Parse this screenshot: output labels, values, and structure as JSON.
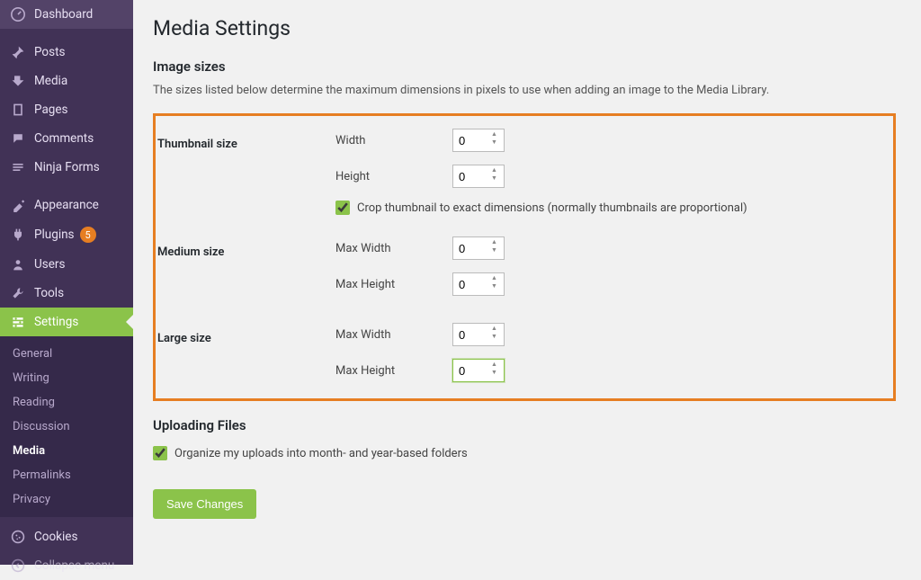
{
  "sidebar": {
    "items": [
      {
        "icon": "dashboard",
        "label": "Dashboard"
      },
      {
        "icon": "pin",
        "label": "Posts"
      },
      {
        "icon": "media",
        "label": "Media"
      },
      {
        "icon": "page",
        "label": "Pages"
      },
      {
        "icon": "comment",
        "label": "Comments"
      },
      {
        "icon": "form",
        "label": "Ninja Forms"
      },
      {
        "icon": "appearance",
        "label": "Appearance"
      },
      {
        "icon": "plugin",
        "label": "Plugins",
        "badge": "5"
      },
      {
        "icon": "user",
        "label": "Users"
      },
      {
        "icon": "tool",
        "label": "Tools"
      },
      {
        "icon": "settings",
        "label": "Settings"
      }
    ],
    "submenu": [
      {
        "label": "General"
      },
      {
        "label": "Writing"
      },
      {
        "label": "Reading"
      },
      {
        "label": "Discussion"
      },
      {
        "label": "Media",
        "current": true
      },
      {
        "label": "Permalinks"
      },
      {
        "label": "Privacy"
      }
    ],
    "footer": [
      {
        "icon": "cookie",
        "label": "Cookies"
      },
      {
        "icon": "collapse",
        "label": "Collapse menu"
      }
    ]
  },
  "page": {
    "title": "Media Settings",
    "section_image_sizes": "Image sizes",
    "image_sizes_desc": "The sizes listed below determine the maximum dimensions in pixels to use when adding an image to the Media Library.",
    "thumbnail": {
      "label": "Thumbnail size",
      "width_label": "Width",
      "height_label": "Height",
      "width": "0",
      "height": "0",
      "crop_label": "Crop thumbnail to exact dimensions (normally thumbnails are proportional)",
      "crop_checked": true
    },
    "medium": {
      "label": "Medium size",
      "maxw_label": "Max Width",
      "maxh_label": "Max Height",
      "maxw": "0",
      "maxh": "0"
    },
    "large": {
      "label": "Large size",
      "maxw_label": "Max Width",
      "maxh_label": "Max Height",
      "maxw": "0",
      "maxh": "0"
    },
    "uploading_title": "Uploading Files",
    "organize_label": "Organize my uploads into month- and year-based folders",
    "organize_checked": true,
    "save_label": "Save Changes"
  }
}
